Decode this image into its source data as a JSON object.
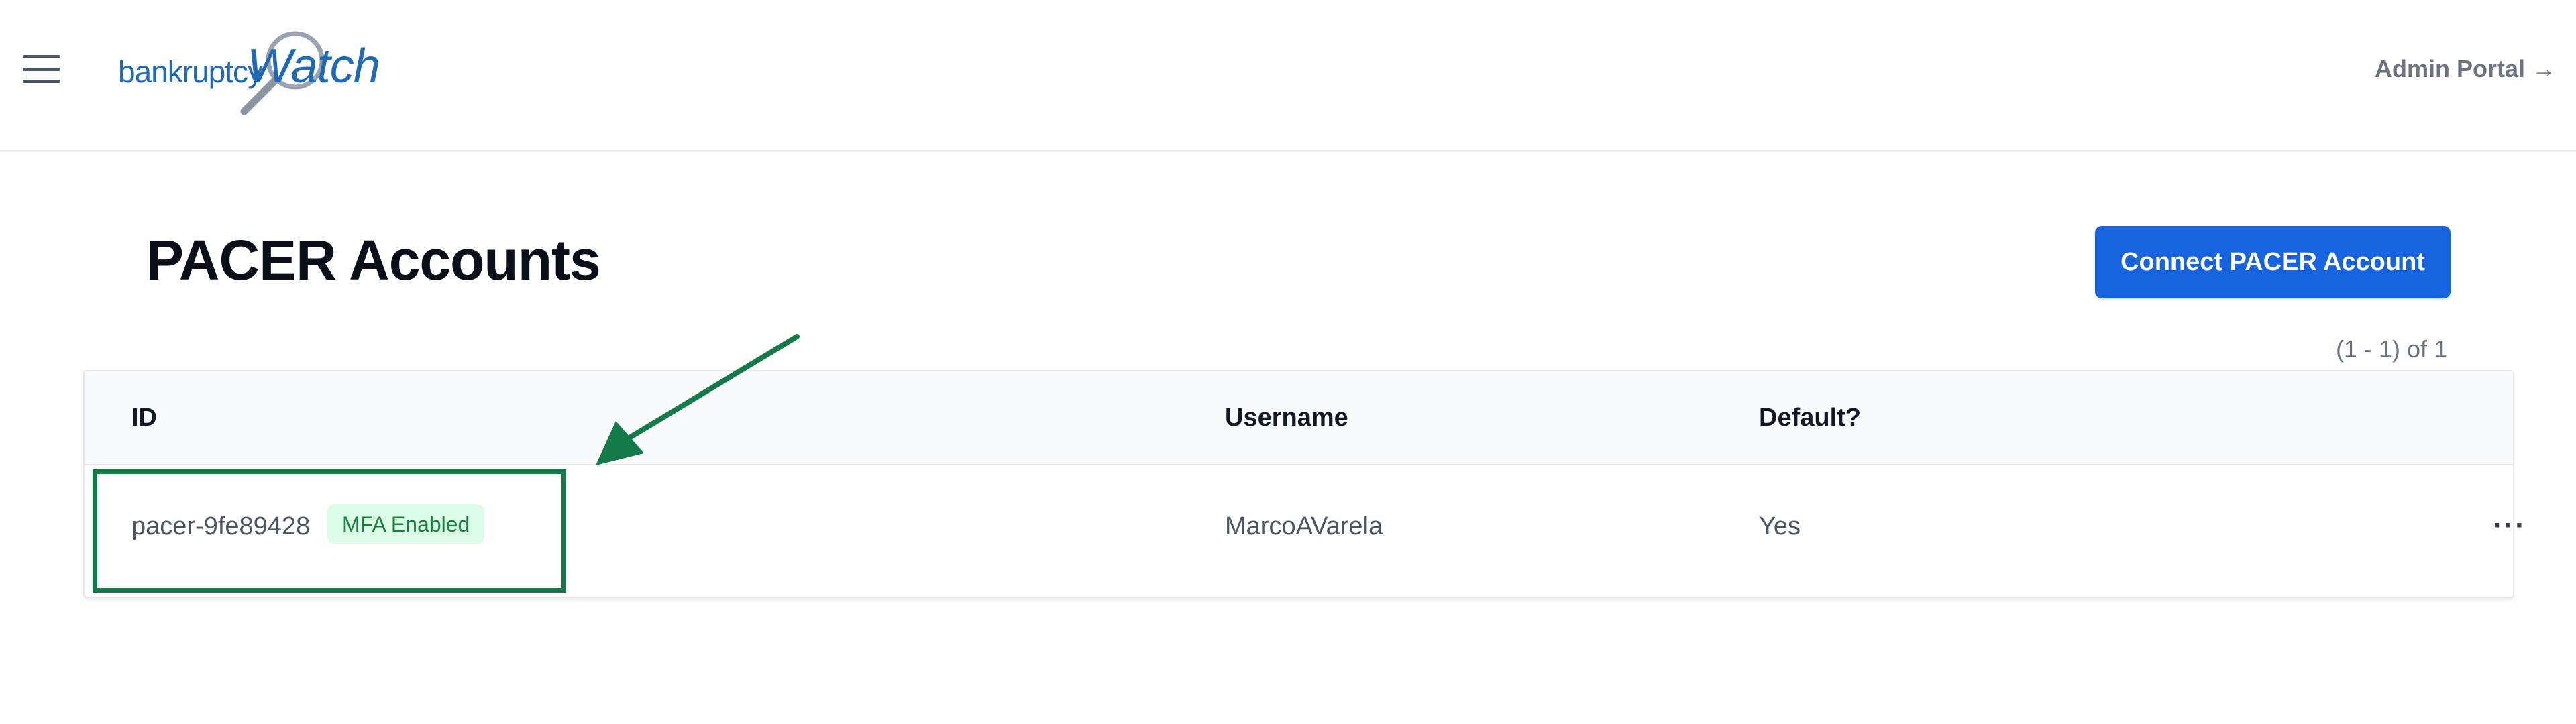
{
  "header": {
    "logo": {
      "part1": "bankruptcy",
      "part2": "Watch"
    },
    "admin_link": "Admin Portal →"
  },
  "page": {
    "title": "PACER Accounts",
    "connect_button": "Connect PACER Account",
    "pagination": "(1 - 1) of 1"
  },
  "table": {
    "columns": [
      "ID",
      "Username",
      "Default?"
    ],
    "rows": [
      {
        "id": "pacer-9fe89428",
        "badge": "MFA Enabled",
        "username": "MarcoAVarela",
        "default": "Yes",
        "menu": "···"
      }
    ]
  },
  "colors": {
    "primary": "#1663e0",
    "logo": "#1f69b5",
    "badge_bg": "#dcfce7",
    "badge_text": "#15803d",
    "annotation": "#157a4a"
  }
}
